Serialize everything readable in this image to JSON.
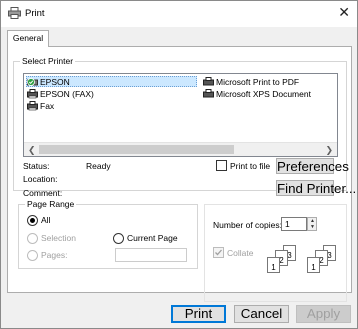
{
  "window": {
    "title": "Print",
    "close_glyph": "✕"
  },
  "tabs": [
    {
      "label": "General"
    }
  ],
  "select_printer": {
    "label": "Select Printer",
    "printers": [
      {
        "name": "EPSON",
        "icon": "printer-default-icon",
        "selected": true
      },
      {
        "name": "EPSON (FAX)",
        "icon": "fax-printer-icon"
      },
      {
        "name": "Fax",
        "icon": "fax-printer-icon"
      },
      {
        "name": "Microsoft Print to PDF",
        "icon": "printer-icon"
      },
      {
        "name": "Microsoft XPS Document",
        "icon": "printer-icon"
      }
    ],
    "status_label": "Status:",
    "status_value": "Ready",
    "location_label": "Location:",
    "comment_label": "Comment:",
    "print_to_file_label": "Print to file",
    "preferences_label": "Preferences",
    "find_printer_label": "Find Printer..."
  },
  "page_range": {
    "label": "Page Range",
    "all_label": "All",
    "selection_label": "Selection",
    "current_page_label": "Current Page",
    "pages_label": "Pages:",
    "selected": "All"
  },
  "copies": {
    "number_label": "Number of copies:",
    "value": "1",
    "collate_label": "Collate",
    "collate_checked": true,
    "collate_disabled": true,
    "page_numbers": [
      "1",
      "2",
      "3"
    ]
  },
  "footer": {
    "print_label": "Print",
    "cancel_label": "Cancel",
    "apply_label": "Apply"
  },
  "colors": {
    "selection_highlight": "#cce8ff",
    "focus_border": "#0078d7",
    "dialog_bg": "#f0f0f0"
  }
}
